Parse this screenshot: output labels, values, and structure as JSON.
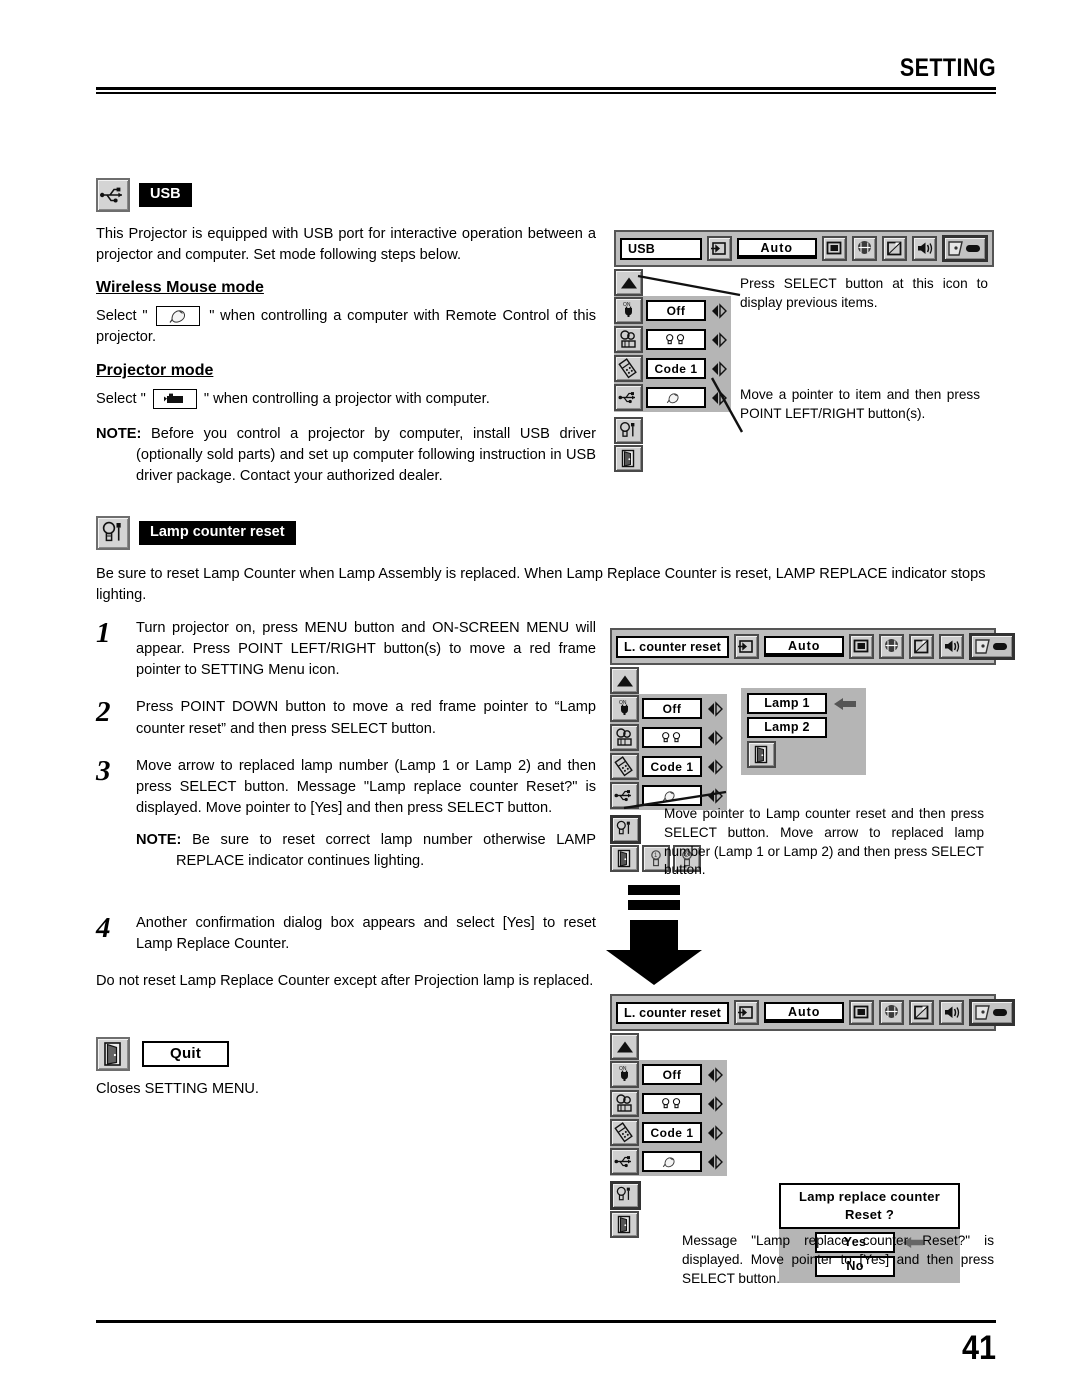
{
  "header": {
    "title": "SETTING"
  },
  "footer": {
    "page_number": "41"
  },
  "usb_section": {
    "icon_name": "usb-icon",
    "badge_label": "USB",
    "intro": "This Projector is equipped with USB port for interactive operation between a projector and computer. Set mode following steps below.",
    "wireless_heading": "Wireless Mouse mode",
    "wireless_text_before": "Select \"",
    "wireless_text_after": "\" when controlling a computer with Remote Control of this projector.",
    "projector_heading": "Projector mode",
    "projector_text_before": "Select \"",
    "projector_text_after": "\" when controlling a projector with computer.",
    "note_label": "NOTE:",
    "note_text": "Before you control a projector by computer, install USB driver (optionally sold parts) and set up computer following instruction in USB driver package. Contact your authorized dealer."
  },
  "usb_menu": {
    "title": "USB",
    "auto_label": "Auto",
    "toolbar_icons": [
      "input-icon",
      "screen-icon",
      "color-icon",
      "image-icon",
      "sound-icon",
      "setting-icon"
    ],
    "rows": [
      {
        "icon": "power-management-icon",
        "value": "Off"
      },
      {
        "icon": "lamp-mode-icon",
        "value": ""
      },
      {
        "icon": "remote-control-icon",
        "value": "Code 1"
      },
      {
        "icon": "usb-icon",
        "value": ""
      }
    ],
    "side_icons": [
      "lamp-counter-reset-icon",
      "quit-icon"
    ],
    "callout_top": "Press SELECT button at this icon to display previous items.",
    "callout_bottom": "Move a pointer to item and then press POINT LEFT/RIGHT button(s)."
  },
  "lamp_section": {
    "icon_name": "lamp-counter-reset-icon",
    "badge_label": "Lamp counter reset",
    "intro": "Be sure to reset Lamp Counter when Lamp Assembly is replaced.  When Lamp Replace Counter is reset, LAMP REPLACE indicator stops lighting.",
    "steps": [
      {
        "num": "1",
        "text": "Turn projector on, press MENU button and ON-SCREEN MENU will appear.  Press POINT LEFT/RIGHT button(s) to move a red frame pointer to SETTING Menu icon."
      },
      {
        "num": "2",
        "text": "Press POINT DOWN button to move a red frame pointer to “Lamp counter reset” and then press SELECT button."
      },
      {
        "num": "3",
        "text": "Move arrow to replaced lamp number (Lamp 1 or Lamp 2) and then press SELECT button.  Message \"Lamp replace counter Reset?\" is displayed. Move pointer to [Yes] and then press SELECT button."
      },
      {
        "num": "4",
        "text": "Another confirmation dialog box appears and select [Yes] to reset Lamp Replace Counter."
      }
    ],
    "step3_note_label": "NOTE:",
    "step3_note_text": "Be sure to reset correct lamp number otherwise LAMP REPLACE indicator continues lighting.",
    "closing_text": "Do not reset Lamp Replace Counter except after Projection lamp is replaced."
  },
  "quit_section": {
    "icon_name": "quit-icon",
    "label": "Quit",
    "description": "Closes SETTING MENU."
  },
  "lamp_menu_1": {
    "title": "L. counter reset",
    "auto_label": "Auto",
    "rows": [
      {
        "icon": "power-management-icon",
        "value": "Off"
      },
      {
        "icon": "lamp-mode-icon",
        "value": ""
      },
      {
        "icon": "remote-control-icon",
        "value": "Code 1"
      },
      {
        "icon": "usb-icon",
        "value": ""
      }
    ],
    "submenu": {
      "items": [
        "Lamp 1",
        "Lamp 2"
      ],
      "quit_icon": "quit-icon",
      "pointer": "left-arrow-icon"
    },
    "callout": "Move pointer to Lamp counter reset and then press SELECT button.  Move arrow to replaced lamp number (Lamp 1 or Lamp 2) and then press SELECT button."
  },
  "lamp_menu_2": {
    "title": "L. counter reset",
    "auto_label": "Auto",
    "rows": [
      {
        "icon": "power-management-icon",
        "value": "Off"
      },
      {
        "icon": "lamp-mode-icon",
        "value": ""
      },
      {
        "icon": "remote-control-icon",
        "value": "Code 1"
      },
      {
        "icon": "usb-icon",
        "value": ""
      }
    ],
    "dialog": {
      "line1": "Lamp replace counter",
      "line2": "Reset ?",
      "yes": "Yes",
      "no": "No",
      "pointer": "left-arrow-icon"
    },
    "callout": "Message \"Lamp replace counter Reset?\" is displayed. Move pointer to [Yes] and then press SELECT button."
  },
  "flow_arrow": {
    "icon_name": "down-arrow-icon"
  }
}
